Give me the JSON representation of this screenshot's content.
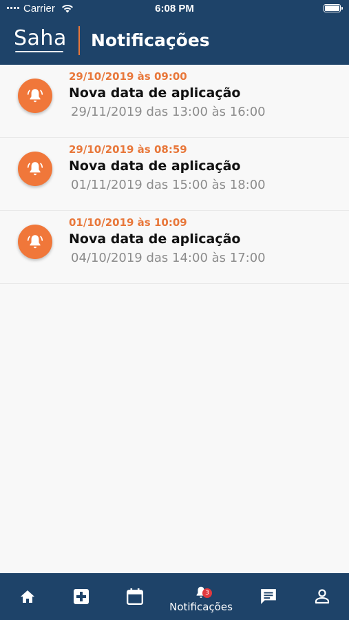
{
  "status_bar": {
    "carrier": "Carrier",
    "time": "6:08 PM"
  },
  "header": {
    "logo": "Saha",
    "title": "Notificações"
  },
  "notifications": [
    {
      "date": "29/10/2019 às 09:00",
      "title": "Nova data de aplicação",
      "detail": "29/11/2019 das 13:00 às 16:00",
      "icon": "bell-icon"
    },
    {
      "date": "29/10/2019 às 08:59",
      "title": "Nova data de aplicação",
      "detail": "01/11/2019 das 15:00 às 18:00",
      "icon": "bell-icon"
    },
    {
      "date": "01/10/2019 às 10:09",
      "title": "Nova data de aplicação",
      "detail": "04/10/2019 das 14:00 às 17:00",
      "icon": "bell-icon"
    }
  ],
  "tab_bar": {
    "active_label": "Notificações",
    "notification_badge": "3",
    "tabs": [
      "home-icon",
      "medical-plus-icon",
      "calendar-icon",
      "bell-icon",
      "chat-icon",
      "profile-icon"
    ]
  },
  "colors": {
    "primary": "#1e4369",
    "accent": "#f0773a",
    "badge": "#e0393e"
  }
}
